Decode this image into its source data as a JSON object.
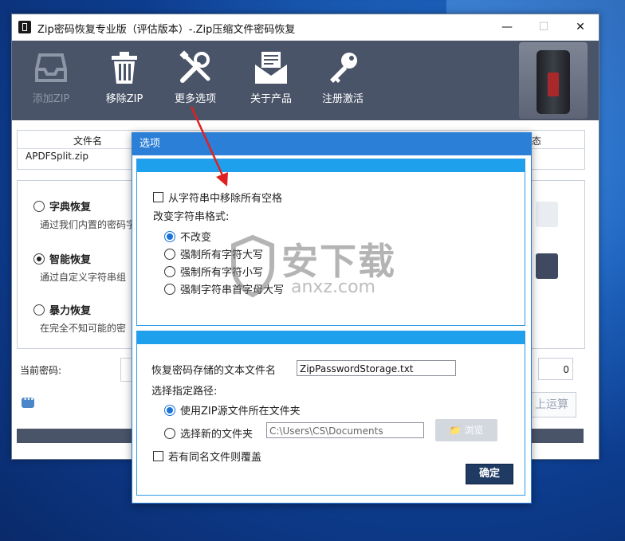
{
  "window": {
    "title": "Zip密码恢复专业版（评估版本）-.Zip压缩文件密码恢复",
    "min_glyph": "—",
    "max_glyph": "☐",
    "close_glyph": "✕"
  },
  "toolbar": {
    "add_zip": "添加ZIP",
    "remove_zip": "移除ZIP",
    "more_options": "更多选项",
    "about": "关于产品",
    "register": "注册激活"
  },
  "file_table": {
    "header_filename": "文件名",
    "header_tail": "态",
    "rows": [
      {
        "filename": "APDFSplit.zip"
      }
    ]
  },
  "modes": [
    {
      "name": "字典恢复",
      "desc": "通过我们内置的密码字",
      "selected": false
    },
    {
      "name": "智能恢复",
      "desc": "通过自定义字符串组",
      "selected": true
    },
    {
      "name": "暴力恢复",
      "desc": "在完全不知可能的密",
      "selected": false
    }
  ],
  "bottom": {
    "current_password_label": "当前密码:",
    "count_value": "0",
    "calc_button": "上运算"
  },
  "dialog": {
    "title": "选项",
    "remove_spaces_label": "从字符串中移除所有空格",
    "remove_spaces_checked": false,
    "format_label": "改变字符串格式:",
    "format_options": [
      {
        "label": "不改变",
        "selected": true
      },
      {
        "label": "强制所有字符大写",
        "selected": false
      },
      {
        "label": "强制所有字符小写",
        "selected": false
      },
      {
        "label": "强制字符串首字母大写",
        "selected": false
      }
    ],
    "storage_label": "恢复密码存储的文本文件名",
    "storage_value": "ZipPasswordStorage.txt",
    "path_label": "选择指定路径:",
    "path_option_zip": "使用ZIP源文件所在文件夹",
    "path_option_zip_selected": true,
    "path_option_new": "选择新的文件夹",
    "path_option_new_selected": false,
    "path_value": "C:\\Users\\CS\\Documents",
    "browse_label": "浏览",
    "overwrite_label": "若有同名文件则覆盖",
    "overwrite_checked": false,
    "ok_label": "确定"
  },
  "watermark": {
    "text": "安下载",
    "sub": "anxz.com"
  },
  "colors": {
    "toolbar": "#4a5468",
    "dialog_accent": "#2b7fd6",
    "ok_button": "#1f3a63",
    "arrow": "#e02020"
  }
}
